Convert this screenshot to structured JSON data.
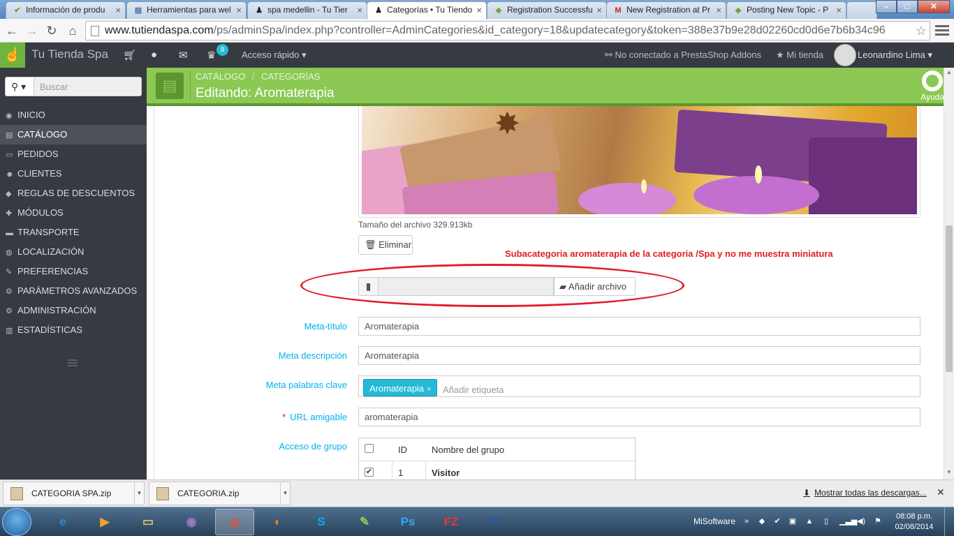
{
  "browser": {
    "tabs": [
      {
        "title": "Información de produ",
        "icon": "v-icon"
      },
      {
        "title": "Herramientas para wel",
        "icon": "page-icon"
      },
      {
        "title": "spa medellin - Tu Tier",
        "icon": "ps-icon"
      },
      {
        "title": "Categorías • Tu Tiendo",
        "icon": "ps-icon"
      },
      {
        "title": "Registration Successfu",
        "icon": "bag-icon"
      },
      {
        "title": "New Registration at Pr",
        "icon": "gmail-icon"
      },
      {
        "title": "Posting New Topic - P",
        "icon": "bag-icon"
      }
    ],
    "url_host": "www.tutiendaspa.com",
    "url_path": "/ps/adminSpa/index.php?controller=AdminCategories&id_category=18&updatecategory&token=388e37b9e28d02260cd0d6e7b6b34c96"
  },
  "header": {
    "shop_name": "Tu Tienda Spa",
    "notification_count": "8",
    "quick_access": "Acceso rápido",
    "addons_status": "No conectado a PrestaShop Addons",
    "my_shop": "Mi tienda",
    "user_name": "Leonardino Lima"
  },
  "sidebar": {
    "search_placeholder": "Buscar",
    "items": [
      {
        "label": "INICIO",
        "icon": "dashboard-icon",
        "active": false
      },
      {
        "label": "CATÁLOGO",
        "icon": "book-icon",
        "active": true
      },
      {
        "label": "PEDIDOS",
        "icon": "credit-card-icon",
        "active": false
      },
      {
        "label": "CLIENTES",
        "icon": "users-icon",
        "active": false
      },
      {
        "label": "REGLAS DE DESCUENTOS",
        "icon": "tags-icon",
        "active": false
      },
      {
        "label": "MÓDULOS",
        "icon": "puzzle-icon",
        "active": false
      },
      {
        "label": "TRANSPORTE",
        "icon": "truck-icon",
        "active": false
      },
      {
        "label": "LOCALIZACIÓN",
        "icon": "globe-icon",
        "active": false
      },
      {
        "label": "PREFERENCIAS",
        "icon": "wrench-icon",
        "active": false
      },
      {
        "label": "PARÁMETROS AVANZADOS",
        "icon": "cogs-icon",
        "active": false
      },
      {
        "label": "ADMINISTRACIÓN",
        "icon": "cog-icon",
        "active": false
      },
      {
        "label": "ESTADÍSTICAS",
        "icon": "bar-chart-icon",
        "active": false
      }
    ]
  },
  "titlebar": {
    "breadcrumb_1": "CATÁLOGO",
    "breadcrumb_sep": "/",
    "breadcrumb_2": "CATEGORÍAS",
    "title": "Editando: Aromaterapia",
    "help": "Ayuda"
  },
  "form": {
    "file_size": "Tamaño del archivo 329.913kb",
    "delete_label": "Eliminar",
    "annotation": "Subacategoria aromaterapia de la categoria /Spa y no me muestra miniatura",
    "add_file_label": "Añadir archivo",
    "meta_title_label": "Meta-título",
    "meta_title_value": "Aromaterapia",
    "meta_desc_label": "Meta descripción",
    "meta_desc_value": "Aromaterapia",
    "meta_keywords_label": "Meta palabras clave",
    "meta_keyword_tag": "Aromaterapia",
    "tag_placeholder": "Añadir etiqueta",
    "friendly_url_label": "URL amigable",
    "friendly_url_value": "aromaterapia",
    "group_access_label": "Acceso de grupo",
    "group_table": {
      "col_id": "ID",
      "col_name": "Nombre del grupo",
      "rows": [
        {
          "id": "1",
          "name": "Visitor",
          "checked": true
        }
      ]
    }
  },
  "downloads": {
    "items": [
      "CATEGORIA SPA.zip",
      "CATEGORIA.zip"
    ],
    "show_all": "Mostrar todas las descargas..."
  },
  "taskbar": {
    "toolbar_label": "MiSoftware",
    "time": "08:08 p.m.",
    "date": "02/08/2014"
  },
  "colors": {
    "ps_green": "#8bc954",
    "ps_dark": "#363a41",
    "ps_blue": "#25b9d7",
    "annotation_red": "#e31d2b"
  }
}
